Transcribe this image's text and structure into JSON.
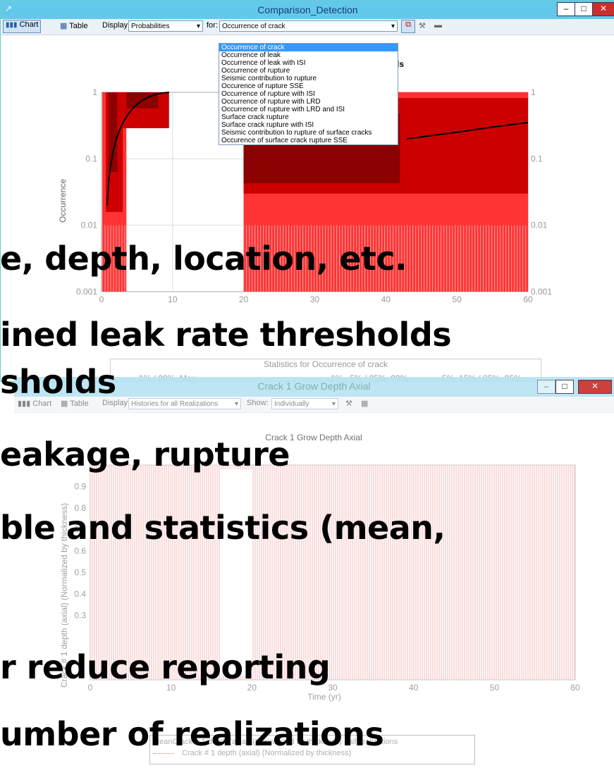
{
  "win1": {
    "title": "Comparison_Detection",
    "chart_label": "Chart",
    "table_label": "Table",
    "display_label": "Display:",
    "display_value": "Probabilities",
    "for_label": "for:",
    "for_value": "Occurrence of crack",
    "dropdown_options": [
      "Occurrence of crack",
      "Occurrence of leak",
      "Occurrence of leak with ISI",
      "Occurrence of rupture",
      "Seismic contribution to rupture",
      "Occurence of rupture SSE",
      "Occurrence of rupture with ISI",
      "Occurrence of rupture with LRD",
      "Occurrence of rupture with LRD and ISI",
      "Surface crack rupture",
      "Surface crack rupture with ISI",
      "Seismic contribution to rupture of surface cracks",
      "Occurence of surface crack rupture SSE"
    ],
    "chart_title_fragment": "ls",
    "y_axis_label": "Occurrence",
    "y_ticks_left": [
      "1",
      "0.1",
      "0.01",
      "0.001"
    ],
    "y_ticks_right": [
      "1",
      "0.1",
      "0.01",
      "0.001"
    ],
    "x_ticks": [
      "0",
      "10",
      "20",
      "30",
      "40",
      "50",
      "60"
    ],
    "x_axis_label_fragment": "r)",
    "stats_title": "Statistics for Occurrence of crack",
    "stats_legend_1": "1% / 99%, Max",
    "stats_legend_2": "1% , 5% / 95%, 99%",
    "stats_legend_3": "5%, 15% / 85%, 95%"
  },
  "win2": {
    "title": "Crack 1 Grow Depth Axial",
    "chart_label": "Chart",
    "table_label": "Table",
    "display_label": "Display:",
    "display_value": "Histories for all Realizations",
    "show_label": "Show:",
    "show_value": "Individually",
    "chart_title": "Crack 1 Grow Depth Axial",
    "y_axis_label": "Crack # 1 depth (axial) (Normalized by thickness)",
    "y_ticks": [
      "0.9",
      "0.8",
      "0.7",
      "0.6",
      "0.5",
      "0.4",
      "0.3"
    ],
    "x_ticks": [
      "0",
      "10",
      "20",
      "30",
      "40",
      "50",
      "60"
    ],
    "x_axis_label": "Time (yr)",
    "legend_mean": "MeanCrack # 1 depth (axial) (Normalized by thickness) - all realizations",
    "legend_series": "Crack # 1 depth (axial) (Normalized by thickness)"
  },
  "overlay": {
    "line1": "e, depth, location, etc.",
    "line2": "ined leak rate thresholds",
    "line3": "sholds",
    "line4": "eakage, rupture",
    "line5": "ble and statistics (mean,",
    "line6": "r reduce reporting",
    "line7": "umber of realizations"
  },
  "colors": {
    "titlebar": "#63c9ec",
    "band_dark": "#8b0000",
    "band_mid": "#cc0000",
    "band_light": "#ff3333",
    "selection": "#3399ff"
  }
}
